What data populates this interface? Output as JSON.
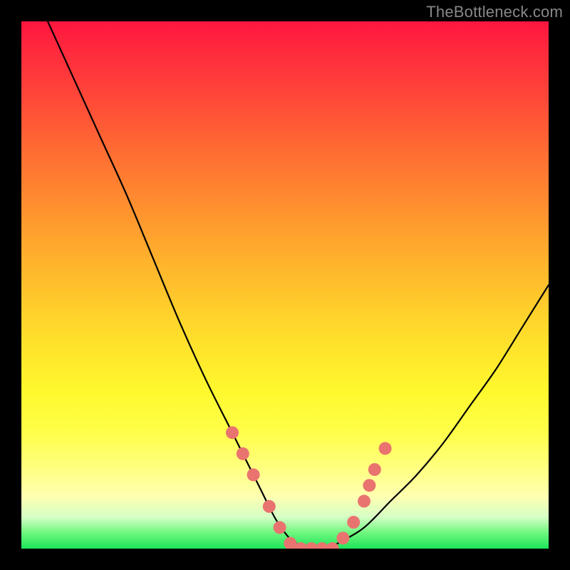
{
  "watermark": "TheBottleneck.com",
  "colors": {
    "background": "#000000",
    "curve": "#000000",
    "dots": "#e9746f"
  },
  "chart_data": {
    "type": "line",
    "title": "",
    "xlabel": "",
    "ylabel": "",
    "xlim": [
      0,
      100
    ],
    "ylim": [
      0,
      100
    ],
    "grid": false,
    "legend": false,
    "series": [
      {
        "name": "bottleneck-curve",
        "x": [
          5,
          10,
          15,
          20,
          25,
          30,
          35,
          40,
          45,
          48,
          50,
          52,
          55,
          58,
          60,
          65,
          70,
          75,
          80,
          85,
          90,
          95,
          100
        ],
        "y": [
          100,
          89,
          78,
          67,
          55,
          43,
          32,
          22,
          12,
          6,
          3,
          1,
          0,
          0,
          1,
          4,
          9,
          14,
          20,
          27,
          34,
          42,
          50
        ]
      }
    ],
    "highlight_points": {
      "name": "marked-range",
      "x": [
        40,
        42,
        44,
        47,
        49,
        51,
        53,
        55,
        57,
        59,
        61,
        63,
        65,
        66,
        67,
        69
      ],
      "y": [
        22,
        18,
        14,
        8,
        4,
        1,
        0,
        0,
        0,
        0,
        2,
        5,
        9,
        12,
        15,
        19
      ]
    }
  }
}
